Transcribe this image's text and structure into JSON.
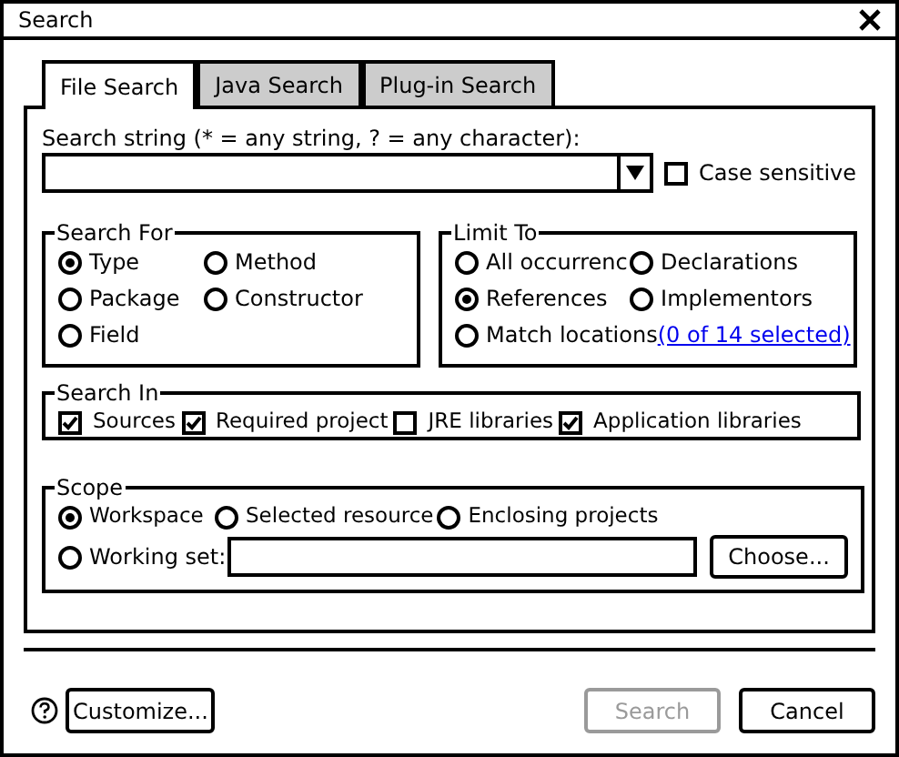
{
  "window": {
    "title": "Search"
  },
  "tabs": [
    {
      "label": "File Search",
      "selected": true
    },
    {
      "label": "Java Search",
      "selected": false
    },
    {
      "label": "Plug-in Search",
      "selected": false
    }
  ],
  "search_string": {
    "label": "Search string (* = any string, ? = any character):",
    "case_sensitive": {
      "label": "Case sensitive",
      "checked": false
    }
  },
  "search_for": {
    "title": "Search For",
    "options": [
      {
        "label": "Type",
        "selected": true
      },
      {
        "label": "Method",
        "selected": false
      },
      {
        "label": "Package",
        "selected": false
      },
      {
        "label": "Constructor",
        "selected": false
      },
      {
        "label": "Field",
        "selected": false
      }
    ]
  },
  "limit_to": {
    "title": "Limit To",
    "options": [
      {
        "label": "All occurrenc",
        "selected": false
      },
      {
        "label": "Declarations",
        "selected": false
      },
      {
        "label": "References",
        "selected": true
      },
      {
        "label": "Implementors",
        "selected": false
      },
      {
        "label": "Match locations",
        "selected": false
      }
    ],
    "link": "(0 of 14 selected)"
  },
  "search_in": {
    "title": "Search In",
    "options": [
      {
        "label": "Sources",
        "checked": true
      },
      {
        "label": "Required project",
        "checked": true
      },
      {
        "label": "JRE libraries",
        "checked": false
      },
      {
        "label": "Application libraries",
        "checked": true
      }
    ]
  },
  "scope": {
    "title": "Scope",
    "options": [
      {
        "label": "Workspace",
        "selected": true
      },
      {
        "label": "Selected resource",
        "selected": false
      },
      {
        "label": "Enclosing projects",
        "selected": false
      },
      {
        "label": "Working set:",
        "selected": false
      }
    ],
    "choose_button": "Choose..."
  },
  "buttons": [
    {
      "label": "Customize...",
      "disabled": false
    },
    {
      "label": "Search",
      "disabled": true
    },
    {
      "label": "Cancel",
      "disabled": false
    }
  ]
}
